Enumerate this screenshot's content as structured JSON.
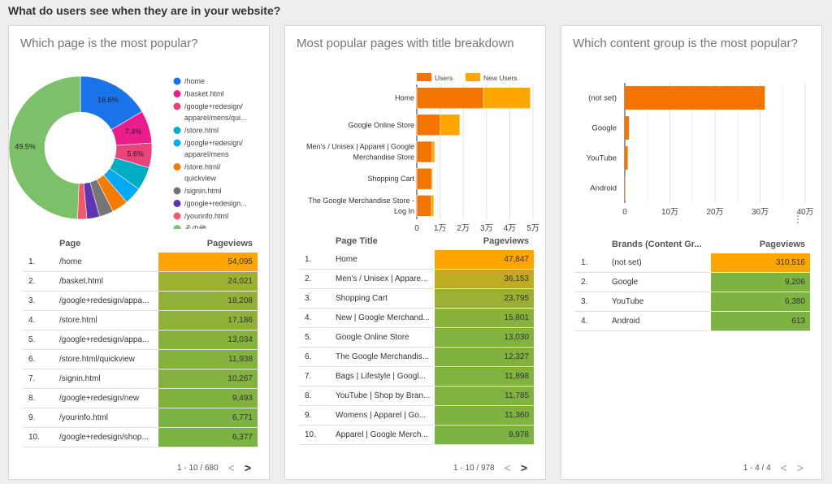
{
  "section_title": "What do users see when they are in your website?",
  "panels": [
    {
      "title": "Which page is the most popular?",
      "table": {
        "headers": [
          "Page",
          "Pageviews"
        ],
        "rows": [
          {
            "idx": "1.",
            "label": "/home",
            "value": "54,095",
            "num": 54095
          },
          {
            "idx": "2.",
            "label": "/basket.html",
            "value": "24,021",
            "num": 24021
          },
          {
            "idx": "3.",
            "label": "/google+redesign/appa...",
            "value": "18,208",
            "num": 18208
          },
          {
            "idx": "4.",
            "label": "/store.html",
            "value": "17,186",
            "num": 17186
          },
          {
            "idx": "5.",
            "label": "/google+redesign/appa...",
            "value": "13,034",
            "num": 13034
          },
          {
            "idx": "6.",
            "label": "/store.html/quickview",
            "value": "11,938",
            "num": 11938
          },
          {
            "idx": "7.",
            "label": "/signin.html",
            "value": "10,267",
            "num": 10267
          },
          {
            "idx": "8.",
            "label": "/google+redesign/new",
            "value": "9,493",
            "num": 9493
          },
          {
            "idx": "9.",
            "label": "/yourinfo.html",
            "value": "6,771",
            "num": 6771
          },
          {
            "idx": "10.",
            "label": "/google+redesign/shop...",
            "value": "6,377",
            "num": 6377
          }
        ],
        "pager": "1 - 10 / 680",
        "prev": "<",
        "next": ">"
      }
    },
    {
      "title": "Most popular pages with title breakdown",
      "table": {
        "headers": [
          "Page Title",
          "Pageviews"
        ],
        "rows": [
          {
            "idx": "1.",
            "label": "Home",
            "value": "47,847",
            "num": 47847
          },
          {
            "idx": "2.",
            "label": "Men's / Unisex | Appare...",
            "value": "36,153",
            "num": 36153
          },
          {
            "idx": "3.",
            "label": "Shopping Cart",
            "value": "23,795",
            "num": 23795
          },
          {
            "idx": "4.",
            "label": "New | Google Merchand...",
            "value": "15,801",
            "num": 15801
          },
          {
            "idx": "5.",
            "label": "Google Online Store",
            "value": "13,030",
            "num": 13030
          },
          {
            "idx": "6.",
            "label": "The Google Merchandis...",
            "value": "12,327",
            "num": 12327
          },
          {
            "idx": "7.",
            "label": "Bags | Lifestyle | Googl...",
            "value": "11,898",
            "num": 11898
          },
          {
            "idx": "8.",
            "label": "YouTube | Shop by Bran...",
            "value": "11,785",
            "num": 11785
          },
          {
            "idx": "9.",
            "label": "Womens | Apparel | Go...",
            "value": "11,360",
            "num": 11360
          },
          {
            "idx": "10.",
            "label": "Apparel | Google Merch...",
            "value": "9,978",
            "num": 9978
          }
        ],
        "pager": "1 - 10 / 978",
        "prev": "<",
        "next": ">"
      }
    },
    {
      "title": "Which content group is the most popular?",
      "table": {
        "headers": [
          "Brands (Content Gr...",
          "Pageviews"
        ],
        "rows": [
          {
            "idx": "1.",
            "label": "(not set)",
            "value": "310,516",
            "num": 310516
          },
          {
            "idx": "2.",
            "label": "Google",
            "value": "9,206",
            "num": 9206
          },
          {
            "idx": "3.",
            "label": "YouTube",
            "value": "6,380",
            "num": 6380
          },
          {
            "idx": "4.",
            "label": "Android",
            "value": "613",
            "num": 613
          }
        ],
        "pager": "1 - 4 / 4",
        "prev": "<",
        "next": ">"
      }
    }
  ],
  "heat_colors": {
    "max": "#ffa500",
    "min": "#7cb342"
  },
  "chart_data": [
    {
      "type": "pie",
      "title": "Which page is the most popular?",
      "donut": true,
      "legend_position": "right",
      "slices": [
        {
          "label": "/home",
          "value": 16.6,
          "text": "16.6%",
          "color": "#1a73e8"
        },
        {
          "label": "/basket.html",
          "value": 7.4,
          "text": "7.4%",
          "color": "#e91e8c"
        },
        {
          "label": "/google+redesign/ apparel/mens/qui...",
          "value": 5.6,
          "text": "5.6%",
          "color": "#e8437a"
        },
        {
          "label": "/store.html",
          "value": 5.3,
          "text": "",
          "color": "#00acc1"
        },
        {
          "label": "/google+redesign/ apparel/mens",
          "value": 4.0,
          "text": "",
          "color": "#03a9f4"
        },
        {
          "label": "/store.html/ quickview",
          "value": 3.7,
          "text": "",
          "color": "#f57c00"
        },
        {
          "label": "/signin.html",
          "value": 3.2,
          "text": "",
          "color": "#757575"
        },
        {
          "label": "/google+redesign...",
          "value": 2.9,
          "text": "",
          "color": "#5e35b1"
        },
        {
          "label": "/yourinfo.html",
          "value": 2.1,
          "text": "",
          "color": "#ef5a6a"
        },
        {
          "label": "その他",
          "value": 49.5,
          "text": "49.5%",
          "color": "#7cc16a"
        }
      ]
    },
    {
      "type": "bar",
      "orientation": "horizontal",
      "stacked": true,
      "title": "Most popular pages with title breakdown",
      "legend_position": "top",
      "categories": [
        "Home",
        "Google Online Store",
        "Men's / Unisex | Apparel | Google Merchandise Store",
        "Shopping Cart",
        "The Google Merchandise Store - Log In"
      ],
      "series": [
        {
          "name": "Users",
          "color": "#f57400",
          "values": [
            28700,
            10100,
            6600,
            6500,
            6300
          ]
        },
        {
          "name": "New Users",
          "color": "#ffa500",
          "values": [
            20200,
            8400,
            1100,
            300,
            1000
          ]
        }
      ],
      "xlim": [
        0,
        50000
      ],
      "xticks": [
        "0",
        "1万",
        "2万",
        "3万",
        "4万",
        "5万"
      ],
      "grid": true
    },
    {
      "type": "bar",
      "orientation": "horizontal",
      "title": "Which content group is the most popular?",
      "categories": [
        "(not set)",
        "Google",
        "YouTube",
        "Android"
      ],
      "values": [
        310516,
        9206,
        6380,
        613
      ],
      "color": "#f57400",
      "xlim": [
        0,
        400000
      ],
      "xticks": [
        "0",
        "10万",
        "20万",
        "30万",
        "40万"
      ],
      "grid": true
    }
  ]
}
